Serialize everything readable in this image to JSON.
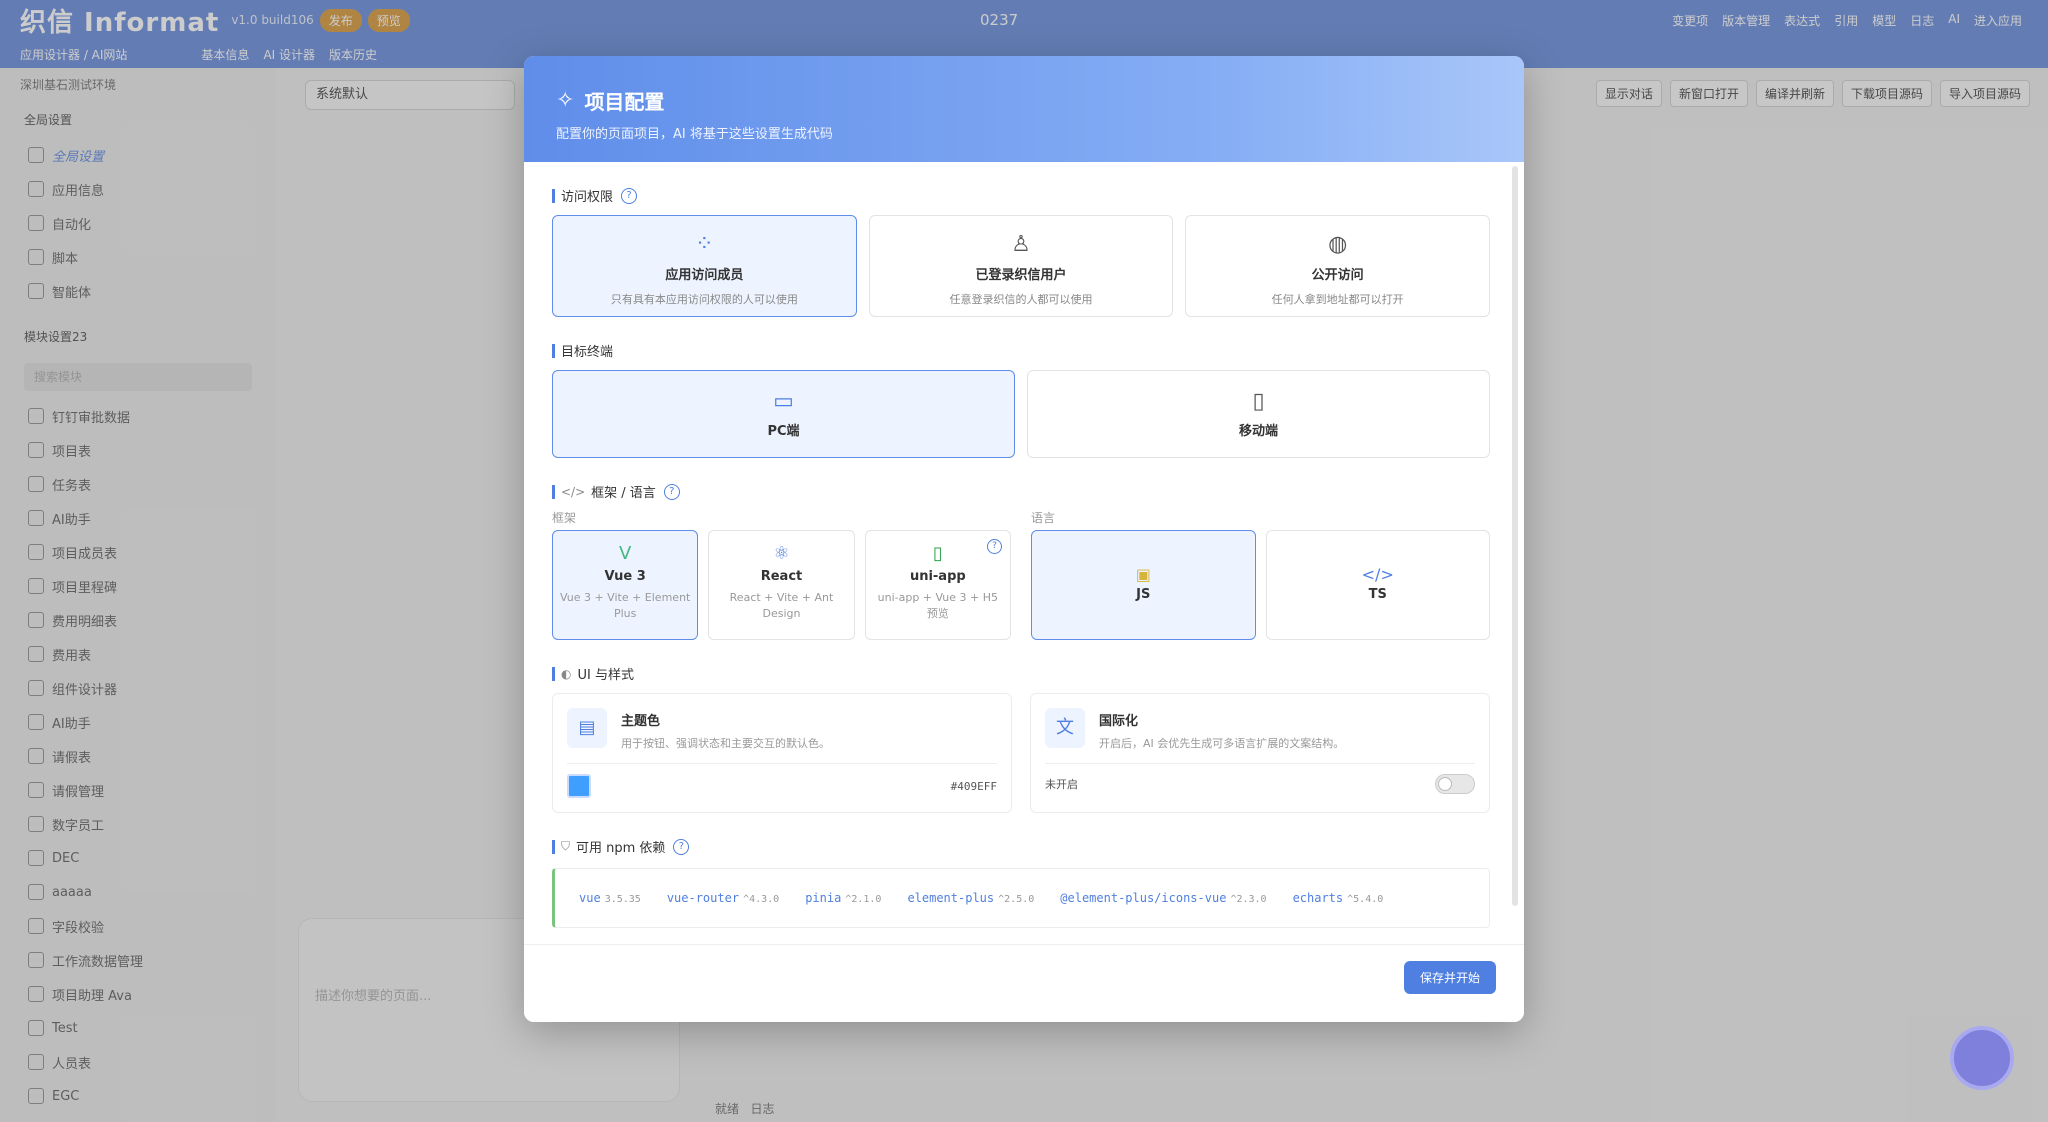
{
  "app": {
    "logo": "织信 Informat",
    "version": "v1.0 build106",
    "publish": "发布",
    "preview": "预览",
    "counter": "0237"
  },
  "top_nav": [
    "变更项",
    "版本管理",
    "表达式",
    "引用",
    "模型",
    "日志",
    "AI",
    "进入应用"
  ],
  "subbar": {
    "breadcrumb": "应用设计器 / AI网站",
    "tabs": [
      "基本信息",
      "AI 设计器",
      "版本历史"
    ]
  },
  "sidebar": {
    "env": "深圳基石测试环境",
    "global": "全局设置",
    "global_items": [
      "全局设置",
      "应用信息",
      "自动化",
      "脚本",
      "智能体"
    ],
    "module_group": "模块设置23",
    "search_placeholder": "搜索模块",
    "modules": [
      "钉钉审批数据",
      "项目表",
      "任务表",
      "AI助手",
      "项目成员表",
      "项目里程碑",
      "费用明细表",
      "费用表",
      "组件设计器",
      "AI助手",
      "请假表",
      "请假管理",
      "数字员工",
      "DEC",
      "aaaaa",
      "字段校验",
      "工作流数据管理",
      "项目助理 Ava",
      "Test",
      "人员表",
      "EGC"
    ]
  },
  "workspace": {
    "select": "系统默认",
    "actions": [
      "显示对话",
      "新窗口打开",
      "编译并刷新",
      "下载项目源码",
      "导入项目源码"
    ],
    "chat_placeholder": "描述你想要的页面...",
    "status_ready": "就绪",
    "status_log": "日志"
  },
  "modal": {
    "title": "项目配置",
    "subtitle": "配置你的页面项目，AI 将基于这些设置生成代码",
    "access": {
      "label": "访问权限",
      "options": [
        {
          "title": "应用访问成员",
          "desc": "只有具有本应用访问权限的人可以使用"
        },
        {
          "title": "已登录织信用户",
          "desc": "任意登录织信的人都可以使用"
        },
        {
          "title": "公开访问",
          "desc": "任何人拿到地址都可以打开"
        }
      ]
    },
    "target": {
      "label": "目标终端",
      "options": [
        "PC端",
        "移动端"
      ]
    },
    "framework": {
      "label": "框架 / 语言",
      "fw_label": "框架",
      "lang_label": "语言",
      "frameworks": [
        {
          "title": "Vue 3",
          "desc": "Vue 3 + Vite + Element Plus"
        },
        {
          "title": "React",
          "desc": "React + Vite + Ant Design"
        },
        {
          "title": "uni-app",
          "desc": "uni-app + Vue 3 + H5 预览"
        }
      ],
      "languages": [
        "JS",
        "TS"
      ]
    },
    "ui": {
      "label": "UI 与样式",
      "theme": {
        "title": "主题色",
        "desc": "用于按钮、强调状态和主要交互的默认色。",
        "value": "#409EFF"
      },
      "i18n": {
        "title": "国际化",
        "desc": "开启后，AI 会优先生成可多语言扩展的文案结构。",
        "state": "未开启"
      }
    },
    "npm": {
      "label": "可用 npm 依赖",
      "packages": [
        {
          "name": "vue",
          "ver": "3.5.35"
        },
        {
          "name": "vue-router",
          "ver": "^4.3.0"
        },
        {
          "name": "pinia",
          "ver": "^2.1.0"
        },
        {
          "name": "element-plus",
          "ver": "^2.5.0"
        },
        {
          "name": "@element-plus/icons-vue",
          "ver": "^2.3.0"
        },
        {
          "name": "echarts",
          "ver": "^5.4.0"
        }
      ]
    },
    "save": "保存并开始"
  }
}
